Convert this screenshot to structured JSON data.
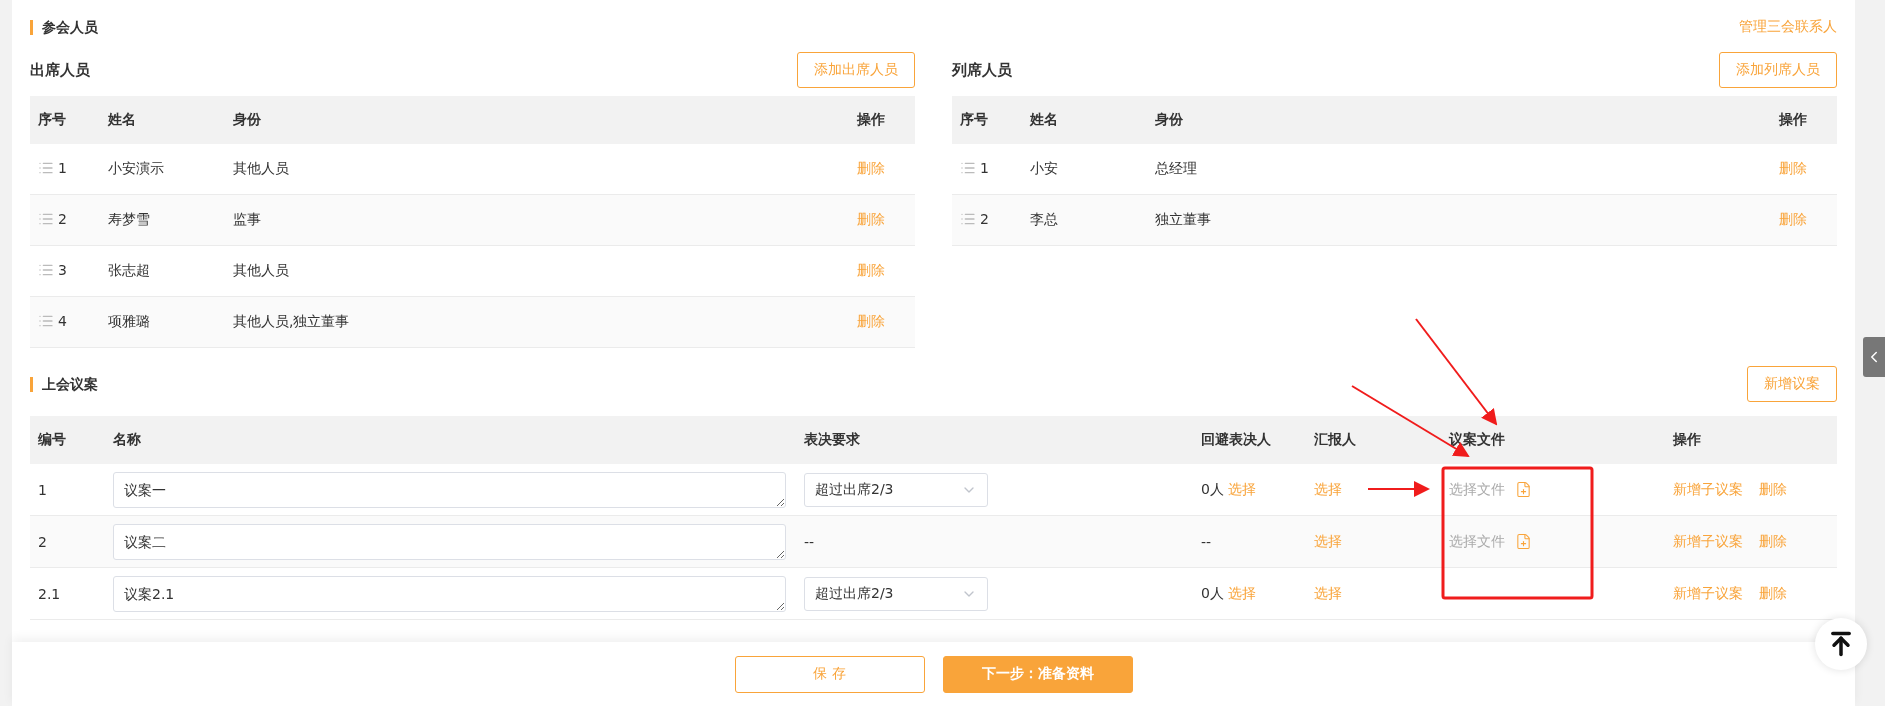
{
  "attendees": {
    "title": "参会人员",
    "link": "管理三会联系人"
  },
  "groups": [
    {
      "title": "出席人员",
      "add_button": "添加出席人员",
      "columns": [
        "序号",
        "姓名",
        "身份",
        "操作"
      ],
      "rows": [
        {
          "index": "1",
          "name": "小安演示",
          "role": "其他人员",
          "action": "删除"
        },
        {
          "index": "2",
          "name": "寿梦雪",
          "role": "监事",
          "action": "删除"
        },
        {
          "index": "3",
          "name": "张志超",
          "role": "其他人员",
          "action": "删除"
        },
        {
          "index": "4",
          "name": "项雅璐",
          "role": "其他人员,独立董事",
          "action": "删除"
        }
      ]
    },
    {
      "title": "列席人员",
      "add_button": "添加列席人员",
      "columns": [
        "序号",
        "姓名",
        "身份",
        "操作"
      ],
      "rows": [
        {
          "index": "1",
          "name": "小安",
          "role": "总经理",
          "action": "删除"
        },
        {
          "index": "2",
          "name": "李总",
          "role": "独立董事",
          "action": "删除"
        }
      ]
    }
  ],
  "motions": {
    "title": "上会议案",
    "add_button": "新增议案",
    "columns": [
      "编号",
      "名称",
      "表决要求",
      "回避表决人",
      "汇报人",
      "议案文件",
      "操作"
    ],
    "rows": [
      {
        "number": "1",
        "name": "议案一",
        "vote": {
          "kind": "select",
          "text": "超过出席2/3"
        },
        "recusal": {
          "kind": "picker",
          "count": "0人",
          "action": "选择"
        },
        "reporter": "选择",
        "file": "选择文件",
        "actions": [
          "新增子议案",
          "删除"
        ]
      },
      {
        "number": "2",
        "name": "议案二",
        "vote": {
          "kind": "text",
          "text": "--"
        },
        "recusal": {
          "kind": "text",
          "text": "--"
        },
        "reporter": "选择",
        "file": "选择文件",
        "actions": [
          "新增子议案",
          "删除"
        ]
      },
      {
        "number": "2.1",
        "name": "议案2.1",
        "vote": {
          "kind": "select",
          "text": "超过出席2/3"
        },
        "recusal": {
          "kind": "picker",
          "count": "0人",
          "action": "选择"
        },
        "reporter": "选择",
        "actions": [
          "新增子议案",
          "删除"
        ]
      }
    ]
  },
  "footer": {
    "buttons": [
      {
        "label": "保 存",
        "kind": "secondary"
      },
      {
        "label": "下一步：准备资料",
        "kind": "primary"
      }
    ]
  }
}
